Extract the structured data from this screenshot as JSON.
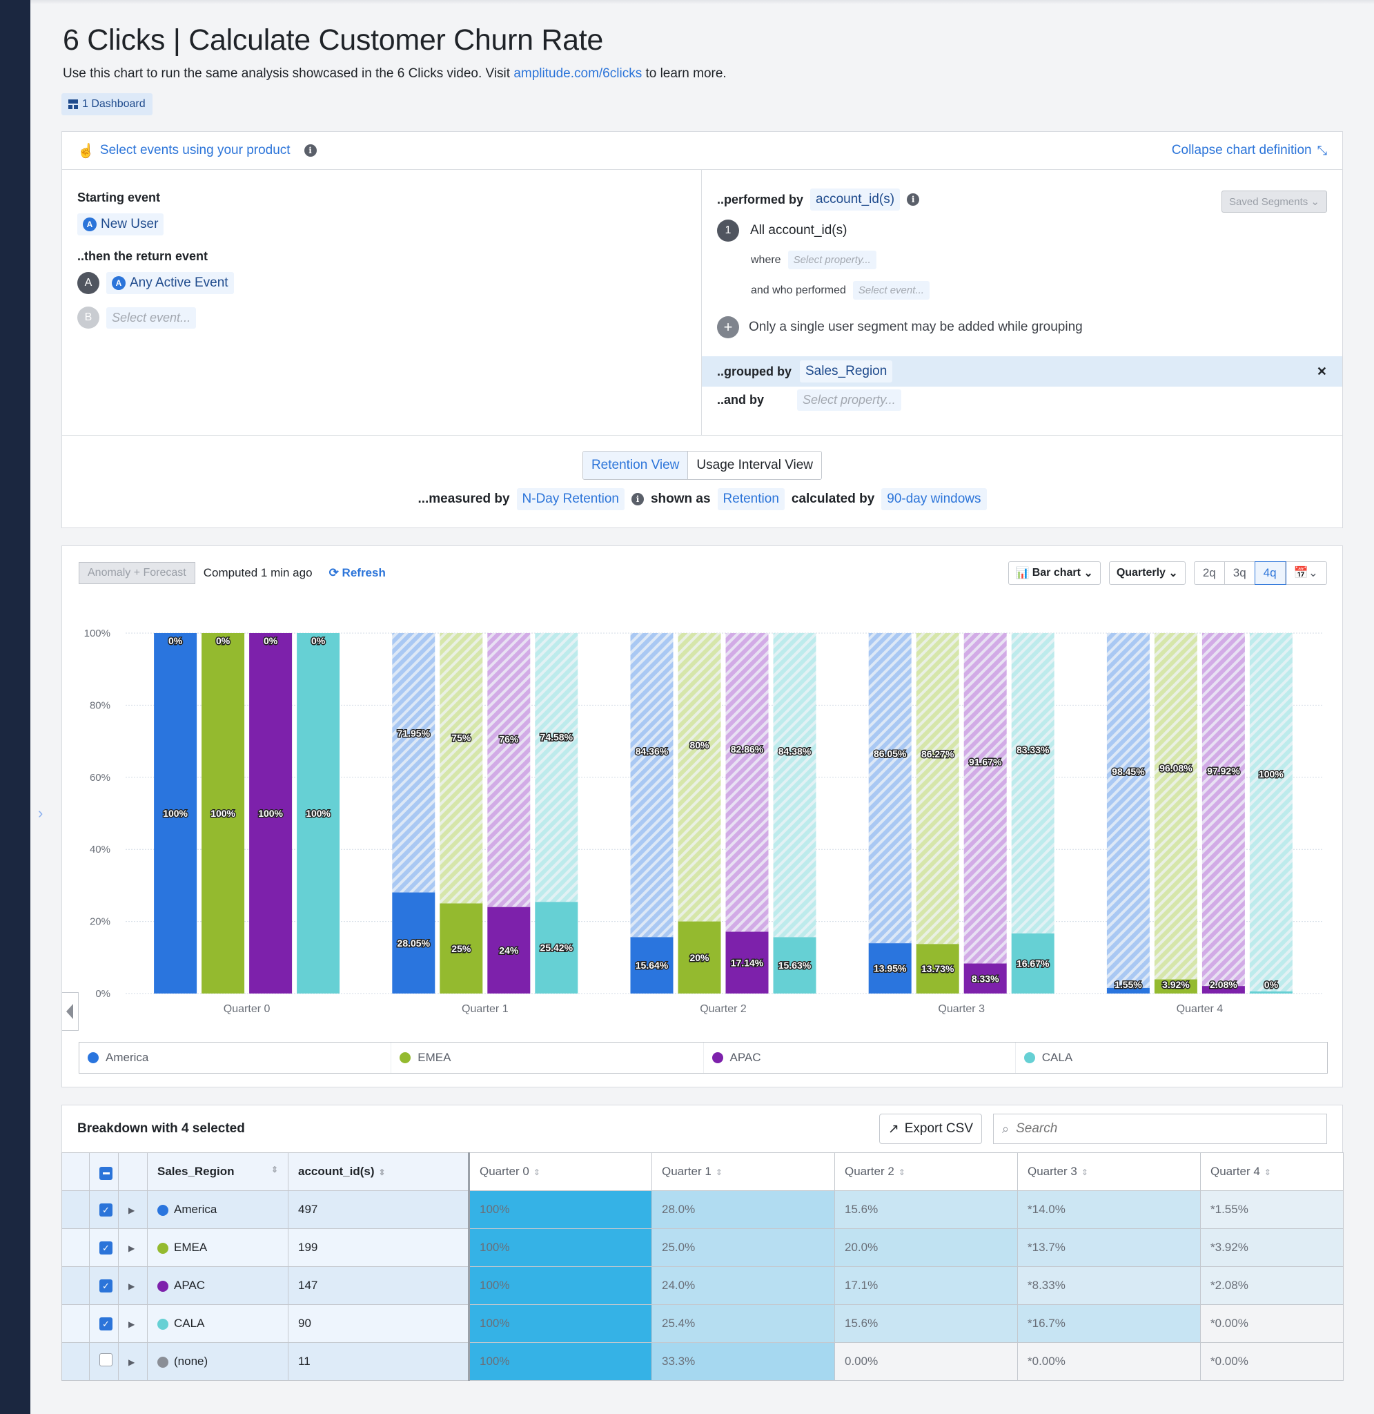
{
  "header": {
    "title": "6 Clicks | Calculate Customer Churn Rate",
    "subtitle_pre": "Use this chart to run the same analysis showcased in the 6 Clicks video. Visit ",
    "subtitle_link": "amplitude.com/6clicks",
    "subtitle_post": " to learn more.",
    "dashboard_badge": "1 Dashboard"
  },
  "definition": {
    "select_events_label": "Select events using your product",
    "collapse_label": "Collapse chart definition",
    "starting_event_label": "Starting event",
    "starting_event": "New User",
    "return_event_label": "..then the return event",
    "return_events": [
      {
        "letter": "A",
        "value": "Any Active Event"
      },
      {
        "letter": "B",
        "placeholder": "Select event..."
      }
    ],
    "performed_by_label": "..performed by",
    "performed_by": "account_id(s)",
    "saved_segments": "Saved Segments",
    "segment_number": "1",
    "segment_name": "All account_id(s)",
    "where_label": "where",
    "where_placeholder": "Select property...",
    "who_performed_label": "and who performed",
    "who_performed_placeholder": "Select event...",
    "add_segment_note": "Only a single user segment may be added while grouping",
    "grouped_by_label": "..grouped by",
    "grouped_by": "Sales_Region",
    "and_by_label": "..and by",
    "and_by_placeholder": "Select property...",
    "views": [
      "Retention View",
      "Usage Interval View"
    ],
    "active_view": "Retention View",
    "measured_by_label": "...measured by",
    "measured_by": "N-Day Retention",
    "shown_as_label": "shown as",
    "shown_as": "Retention",
    "calculated_by_label": "calculated by",
    "calculated_by": "90-day windows"
  },
  "chart_toolbar": {
    "anomaly": "Anomaly + Forecast",
    "computed": "Computed 1 min ago",
    "refresh": "Refresh",
    "chart_type": "Bar chart",
    "interval": "Quarterly",
    "ranges": [
      "2q",
      "3q",
      "4q"
    ],
    "active_range": "4q"
  },
  "chart_data": {
    "type": "bar",
    "stacked": true,
    "categories": [
      "Quarter 0",
      "Quarter 1",
      "Quarter 2",
      "Quarter 3",
      "Quarter 4"
    ],
    "yticks": [
      "0%",
      "20%",
      "40%",
      "60%",
      "80%",
      "100%"
    ],
    "ylim": [
      0,
      100
    ],
    "grid": true,
    "legend_position": "bottom",
    "series": [
      {
        "name": "America",
        "color": "#2a75de",
        "light": "#a9c8f3",
        "retained": [
          100,
          28.05,
          15.64,
          13.95,
          1.55
        ],
        "churned": [
          0,
          71.95,
          84.36,
          86.05,
          98.45
        ],
        "retained_labels": [
          "100%",
          "28.05%",
          "15.64%",
          "13.95%",
          "1.55%"
        ],
        "churned_labels": [
          "0%",
          "71.95%",
          "84.36%",
          "86.05%",
          "98.45%"
        ]
      },
      {
        "name": "EMEA",
        "color": "#94ba2f",
        "light": "#d6e6aa",
        "retained": [
          100,
          25,
          20,
          13.73,
          3.92
        ],
        "churned": [
          0,
          75,
          80,
          86.27,
          96.08
        ],
        "retained_labels": [
          "100%",
          "25%",
          "20%",
          "13.73%",
          "3.92%"
        ],
        "churned_labels": [
          "0%",
          "75%",
          "80%",
          "86.27%",
          "96.08%"
        ]
      },
      {
        "name": "APAC",
        "color": "#7d21ab",
        "light": "#d2abe6",
        "retained": [
          100,
          24,
          17.14,
          8.33,
          2.08
        ],
        "churned": [
          0,
          76,
          82.86,
          91.67,
          97.92
        ],
        "retained_labels": [
          "100%",
          "24%",
          "17.14%",
          "8.33%",
          "2.08%"
        ],
        "churned_labels": [
          "0%",
          "76%",
          "82.86%",
          "91.67%",
          "97.92%"
        ]
      },
      {
        "name": "CALA",
        "color": "#66d0d4",
        "light": "#bdebec",
        "retained": [
          100,
          25.42,
          15.63,
          16.67,
          0
        ],
        "churned": [
          0,
          74.58,
          84.38,
          83.33,
          100
        ],
        "retained_labels": [
          "100%",
          "25.42%",
          "15.63%",
          "16.67%",
          "0%"
        ],
        "churned_labels": [
          "0%",
          "74.58%",
          "84.38%",
          "83.33%",
          "100%"
        ]
      }
    ]
  },
  "breakdown": {
    "title": "Breakdown with 4 selected",
    "export": "Export CSV",
    "search_placeholder": "Search",
    "columns": [
      "Sales_Region",
      "account_id(s)",
      "Quarter 0",
      "Quarter 1",
      "Quarter 2",
      "Quarter 3",
      "Quarter 4"
    ],
    "rows": [
      {
        "checked": true,
        "region": "America",
        "color": "#2a75de",
        "count": "497",
        "values": [
          "100%",
          "28.0%",
          "15.6%",
          "*14.0%",
          "*1.55%"
        ]
      },
      {
        "checked": true,
        "region": "EMEA",
        "color": "#94ba2f",
        "count": "199",
        "values": [
          "100%",
          "25.0%",
          "20.0%",
          "*13.7%",
          "*3.92%"
        ]
      },
      {
        "checked": true,
        "region": "APAC",
        "color": "#7d21ab",
        "count": "147",
        "values": [
          "100%",
          "24.0%",
          "17.1%",
          "*8.33%",
          "*2.08%"
        ]
      },
      {
        "checked": true,
        "region": "CALA",
        "color": "#66d0d4",
        "count": "90",
        "values": [
          "100%",
          "25.4%",
          "15.6%",
          "*16.7%",
          "*0.00%"
        ]
      },
      {
        "checked": false,
        "region": "(none)",
        "color": "#8a8e96",
        "count": "11",
        "values": [
          "100%",
          "33.3%",
          "0.00%",
          "*0.00%",
          "*0.00%"
        ]
      }
    ]
  }
}
